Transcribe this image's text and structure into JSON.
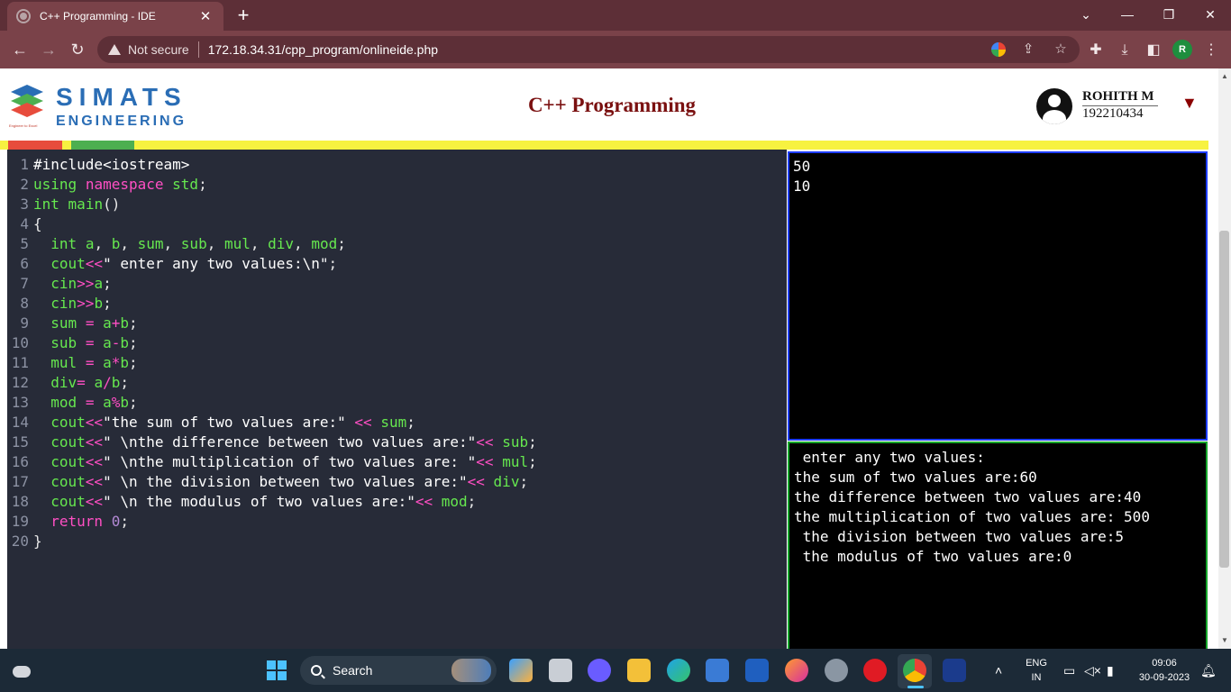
{
  "browser": {
    "tab_title": "C++ Programming - IDE",
    "tab_close": "✕",
    "new_tab": "+",
    "security_label": "Not secure",
    "url": "172.18.34.31/cpp_program/onlineide.php",
    "profile_initial": "R"
  },
  "header": {
    "logo_word": "SIMATS",
    "logo_sub": "ENGINEERING",
    "logo_tagline": "Engineer to Excel",
    "title": "C++ Programming",
    "user_name": "ROHITH M",
    "user_id": "192210434",
    "menu_caret": "▼"
  },
  "editor": {
    "lines": [
      {
        "n": "1",
        "segs": [
          [
            "pp",
            "#include<iostream>"
          ]
        ]
      },
      {
        "n": "2",
        "segs": [
          [
            "ty",
            "using"
          ],
          [
            "code",
            " "
          ],
          [
            "kw",
            "namespace"
          ],
          [
            "code",
            " "
          ],
          [
            "ty",
            "std"
          ],
          [
            "code",
            ";"
          ]
        ]
      },
      {
        "n": "3",
        "segs": [
          [
            "ty",
            "int"
          ],
          [
            "code",
            " "
          ],
          [
            "ty",
            "main"
          ],
          [
            "code",
            "()"
          ]
        ]
      },
      {
        "n": "4",
        "segs": [
          [
            "code",
            "{"
          ]
        ]
      },
      {
        "n": "5",
        "segs": [
          [
            "code",
            "  "
          ],
          [
            "ty",
            "int"
          ],
          [
            "code",
            " "
          ],
          [
            "ty",
            "a"
          ],
          [
            "code",
            ", "
          ],
          [
            "ty",
            "b"
          ],
          [
            "code",
            ", "
          ],
          [
            "ty",
            "sum"
          ],
          [
            "code",
            ", "
          ],
          [
            "ty",
            "sub"
          ],
          [
            "code",
            ", "
          ],
          [
            "ty",
            "mul"
          ],
          [
            "code",
            ", "
          ],
          [
            "ty",
            "div"
          ],
          [
            "code",
            ", "
          ],
          [
            "ty",
            "mod"
          ],
          [
            "code",
            ";"
          ]
        ]
      },
      {
        "n": "6",
        "segs": [
          [
            "code",
            "  "
          ],
          [
            "ty",
            "cout"
          ],
          [
            "op",
            "<<"
          ],
          [
            "str",
            "\" enter any two values:\\n\""
          ],
          [
            "code",
            ";"
          ]
        ]
      },
      {
        "n": "7",
        "segs": [
          [
            "code",
            "  "
          ],
          [
            "ty",
            "cin"
          ],
          [
            "op",
            ">>"
          ],
          [
            "ty",
            "a"
          ],
          [
            "code",
            ";"
          ]
        ]
      },
      {
        "n": "8",
        "segs": [
          [
            "code",
            "  "
          ],
          [
            "ty",
            "cin"
          ],
          [
            "op",
            ">>"
          ],
          [
            "ty",
            "b"
          ],
          [
            "code",
            ";"
          ]
        ]
      },
      {
        "n": "9",
        "segs": [
          [
            "code",
            "  "
          ],
          [
            "ty",
            "sum"
          ],
          [
            "code",
            " "
          ],
          [
            "op",
            "="
          ],
          [
            "code",
            " "
          ],
          [
            "ty",
            "a"
          ],
          [
            "op",
            "+"
          ],
          [
            "ty",
            "b"
          ],
          [
            "code",
            ";"
          ]
        ]
      },
      {
        "n": "10",
        "segs": [
          [
            "code",
            "  "
          ],
          [
            "ty",
            "sub"
          ],
          [
            "code",
            " "
          ],
          [
            "op",
            "="
          ],
          [
            "code",
            " "
          ],
          [
            "ty",
            "a"
          ],
          [
            "op",
            "-"
          ],
          [
            "ty",
            "b"
          ],
          [
            "code",
            ";"
          ]
        ]
      },
      {
        "n": "11",
        "segs": [
          [
            "code",
            "  "
          ],
          [
            "ty",
            "mul"
          ],
          [
            "code",
            " "
          ],
          [
            "op",
            "="
          ],
          [
            "code",
            " "
          ],
          [
            "ty",
            "a"
          ],
          [
            "op",
            "*"
          ],
          [
            "ty",
            "b"
          ],
          [
            "code",
            ";"
          ]
        ]
      },
      {
        "n": "12",
        "segs": [
          [
            "code",
            "  "
          ],
          [
            "ty",
            "div"
          ],
          [
            "op",
            "="
          ],
          [
            "code",
            " "
          ],
          [
            "ty",
            "a"
          ],
          [
            "op",
            "/"
          ],
          [
            "ty",
            "b"
          ],
          [
            "code",
            ";"
          ]
        ]
      },
      {
        "n": "13",
        "segs": [
          [
            "code",
            "  "
          ],
          [
            "ty",
            "mod"
          ],
          [
            "code",
            " "
          ],
          [
            "op",
            "="
          ],
          [
            "code",
            " "
          ],
          [
            "ty",
            "a"
          ],
          [
            "op",
            "%"
          ],
          [
            "ty",
            "b"
          ],
          [
            "code",
            ";"
          ]
        ]
      },
      {
        "n": "14",
        "segs": [
          [
            "code",
            "  "
          ],
          [
            "ty",
            "cout"
          ],
          [
            "op",
            "<<"
          ],
          [
            "str",
            "\"the sum of two values are:\""
          ],
          [
            "code",
            " "
          ],
          [
            "op",
            "<<"
          ],
          [
            "code",
            " "
          ],
          [
            "ty",
            "sum"
          ],
          [
            "code",
            ";"
          ]
        ]
      },
      {
        "n": "15",
        "segs": [
          [
            "code",
            "  "
          ],
          [
            "ty",
            "cout"
          ],
          [
            "op",
            "<<"
          ],
          [
            "str",
            "\" \\nthe difference between two values are:\""
          ],
          [
            "op",
            "<<"
          ],
          [
            "code",
            " "
          ],
          [
            "ty",
            "sub"
          ],
          [
            "code",
            ";"
          ]
        ]
      },
      {
        "n": "16",
        "segs": [
          [
            "code",
            "  "
          ],
          [
            "ty",
            "cout"
          ],
          [
            "op",
            "<<"
          ],
          [
            "str",
            "\" \\nthe multiplication of two values are: \""
          ],
          [
            "op",
            "<<"
          ],
          [
            "code",
            " "
          ],
          [
            "ty",
            "mul"
          ],
          [
            "code",
            ";"
          ]
        ]
      },
      {
        "n": "17",
        "segs": [
          [
            "code",
            "  "
          ],
          [
            "ty",
            "cout"
          ],
          [
            "op",
            "<<"
          ],
          [
            "str",
            "\" \\n the division between two values are:\""
          ],
          [
            "op",
            "<<"
          ],
          [
            "code",
            " "
          ],
          [
            "ty",
            "div"
          ],
          [
            "code",
            ";"
          ]
        ]
      },
      {
        "n": "18",
        "segs": [
          [
            "code",
            "  "
          ],
          [
            "ty",
            "cout"
          ],
          [
            "op",
            "<<"
          ],
          [
            "str",
            "\" \\n the modulus of two values are:\""
          ],
          [
            "op",
            "<<"
          ],
          [
            "code",
            " "
          ],
          [
            "ty",
            "mod"
          ],
          [
            "code",
            ";"
          ]
        ]
      },
      {
        "n": "19",
        "segs": [
          [
            "code",
            "  "
          ],
          [
            "kw",
            "return"
          ],
          [
            "code",
            " "
          ],
          [
            "num",
            "0"
          ],
          [
            "code",
            ";"
          ]
        ]
      },
      {
        "n": "20",
        "segs": [
          [
            "code",
            "}"
          ]
        ]
      }
    ]
  },
  "input_panel": {
    "text": "50\n10"
  },
  "output_panel": {
    "text": " enter any two values:\nthe sum of two values are:60\nthe difference between two values are:40\nthe multiplication of two values are: 500\n the division between two values are:5\n the modulus of two values are:0"
  },
  "taskbar": {
    "search_label": "Search",
    "language_top": "ENG",
    "language_bottom": "IN",
    "time": "09:06",
    "date": "30-09-2023"
  }
}
